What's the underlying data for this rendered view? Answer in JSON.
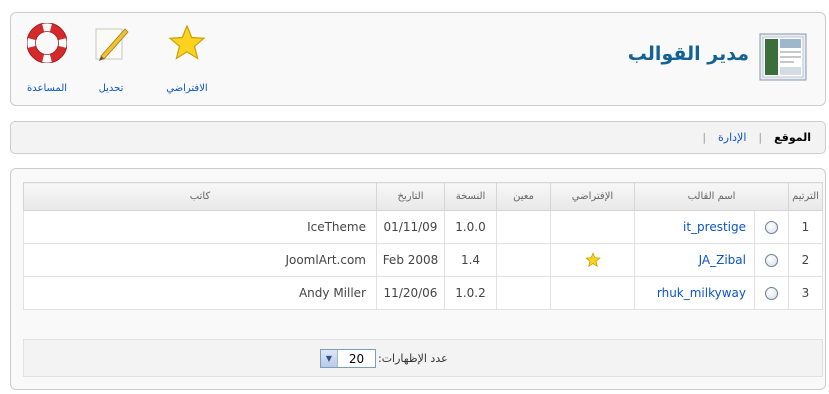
{
  "header": {
    "title": "مدير القوالب",
    "title_icon": "template-manager-icon"
  },
  "toolbar": {
    "help_label": "المساعدة",
    "edit_label": "تحديل",
    "default_label": "الافتراضي"
  },
  "submenu": {
    "items": [
      {
        "label": "الموقع",
        "active": true
      },
      {
        "label": "الإدارة",
        "active": false
      }
    ]
  },
  "table": {
    "headers": {
      "order": "الترتيم",
      "name": "اسم القالب",
      "default": "الإفتراضي",
      "assigned": "معين",
      "version": "النسخة",
      "date": "التاريخ",
      "author": "كاتب"
    },
    "rows": [
      {
        "num": "1",
        "name": "it_prestige",
        "default": false,
        "version": "1.0.0",
        "date": "01/11/09",
        "author": "IceTheme"
      },
      {
        "num": "2",
        "name": "JA_Zibal",
        "default": true,
        "version": "1.4",
        "date": "Feb 2008",
        "author": "JoomlArt.com"
      },
      {
        "num": "3",
        "name": "rhuk_milkyway",
        "default": false,
        "version": "1.0.2",
        "date": "11/20/06",
        "author": "Andy Miller"
      }
    ]
  },
  "footer": {
    "limit_label": "عدد الإظهارات:",
    "limit_value": "20"
  }
}
